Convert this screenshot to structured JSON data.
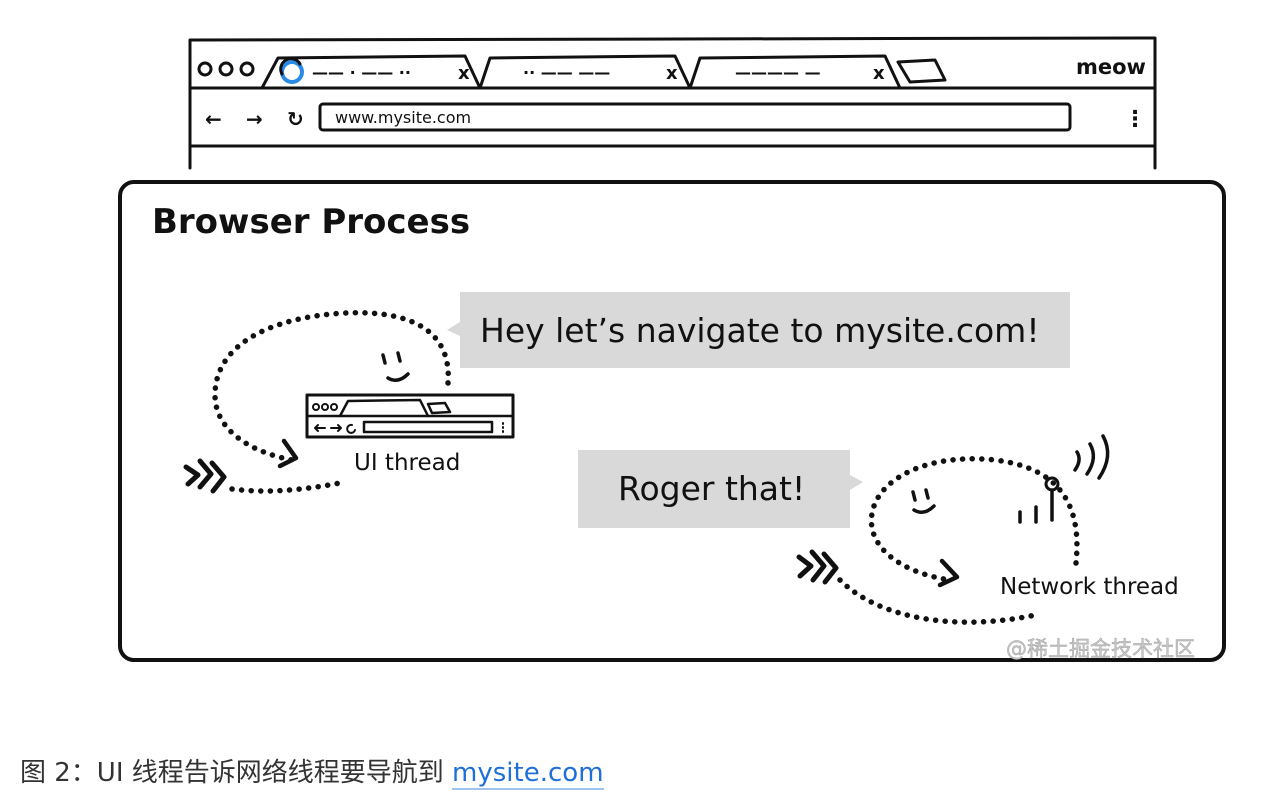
{
  "browser": {
    "tabs": [
      {
        "label": "—— · —— ··"
      },
      {
        "label": "·· —— ——"
      },
      {
        "label": "———— —"
      }
    ],
    "close_glyph": "x",
    "window_title": "meow",
    "nav": {
      "back": "←",
      "forward": "→",
      "reload": "↻"
    },
    "address": "www.mysite.com",
    "menu_glyph": "⋮"
  },
  "process_box": {
    "title": "Browser Process"
  },
  "ui_thread": {
    "label": "UI thread",
    "speech": "Hey let’s navigate to mysite.com!"
  },
  "network_thread": {
    "label": "Network thread",
    "speech": "Roger that!"
  },
  "watermark": "@稀土掘金技术社区",
  "caption": {
    "prefix": "图 2：UI 线程告诉网络线程要导航到 ",
    "link_text": "mysite.com"
  },
  "icons": [
    "spinner-icon",
    "close-icon",
    "new-tab-icon",
    "back-arrow-icon",
    "forward-arrow-icon",
    "reload-icon",
    "kebab-menu-icon",
    "mini-browser-icon",
    "antenna-icon",
    "motion-lines-icon"
  ]
}
